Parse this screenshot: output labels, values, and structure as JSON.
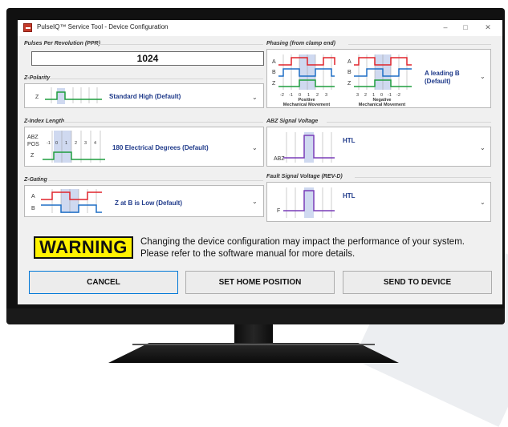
{
  "window": {
    "title": "PulseIQ™ Service Tool - Device Configuration",
    "minimize": "–",
    "maximize": "□",
    "close": "✕"
  },
  "ppr": {
    "label": "Pulses Per Revolution (PPR)",
    "value": "1024"
  },
  "z_polarity": {
    "label": "Z-Polarity",
    "signal": "Z",
    "selected": "Standard High (Default)"
  },
  "z_index_length": {
    "label": "Z-Index Length",
    "row1": "ABZ",
    "row2": "POS",
    "row3": "Z",
    "ticks": [
      "-1",
      "0",
      "1",
      "2",
      "3",
      "4"
    ],
    "selected": "180 Electrical Degrees (Default)"
  },
  "z_gating": {
    "label": "Z-Gating",
    "signals": [
      "A",
      "B"
    ],
    "selected": "Z at B is Low (Default)"
  },
  "phasing": {
    "label": "Phasing (from clamp end)",
    "signals": [
      "A",
      "B",
      "Z"
    ],
    "positive_ticks": [
      "-2",
      "-1",
      "0",
      "1",
      "2",
      "3"
    ],
    "negative_ticks": [
      "3",
      "2",
      "1",
      "0",
      "-1",
      "-2"
    ],
    "positive_caption": [
      "Positive",
      "Mechanical Movement"
    ],
    "negative_caption": [
      "Negative",
      "Mechanical Movement"
    ],
    "selected": [
      "A leading B",
      "(Default)"
    ]
  },
  "abz_voltage": {
    "label": "ABZ Signal Voltage",
    "signal": "ABZ",
    "selected": "HTL"
  },
  "fault_voltage": {
    "label": "Fault Signal Voltage (REV-D)",
    "signal": "F",
    "selected": "HTL"
  },
  "warning": {
    "badge": "WARNING",
    "line1": "Changing the device configuration may impact the performance of your system.",
    "line2": "Please refer to the software manual for more details."
  },
  "buttons": {
    "cancel": "CANCEL",
    "home": "SET HOME POSITION",
    "send": "SEND TO DEVICE"
  },
  "icons": {
    "app": "app-logo-icon",
    "dropdown": "chevron-down-icon"
  },
  "colors": {
    "a_signal": "#e0242b",
    "b_signal": "#1f6fc5",
    "z_signal": "#1e9e3e",
    "voltage_signal": "#7a3db8",
    "warning_bg": "#fff200",
    "focus_border": "#0078d7"
  }
}
